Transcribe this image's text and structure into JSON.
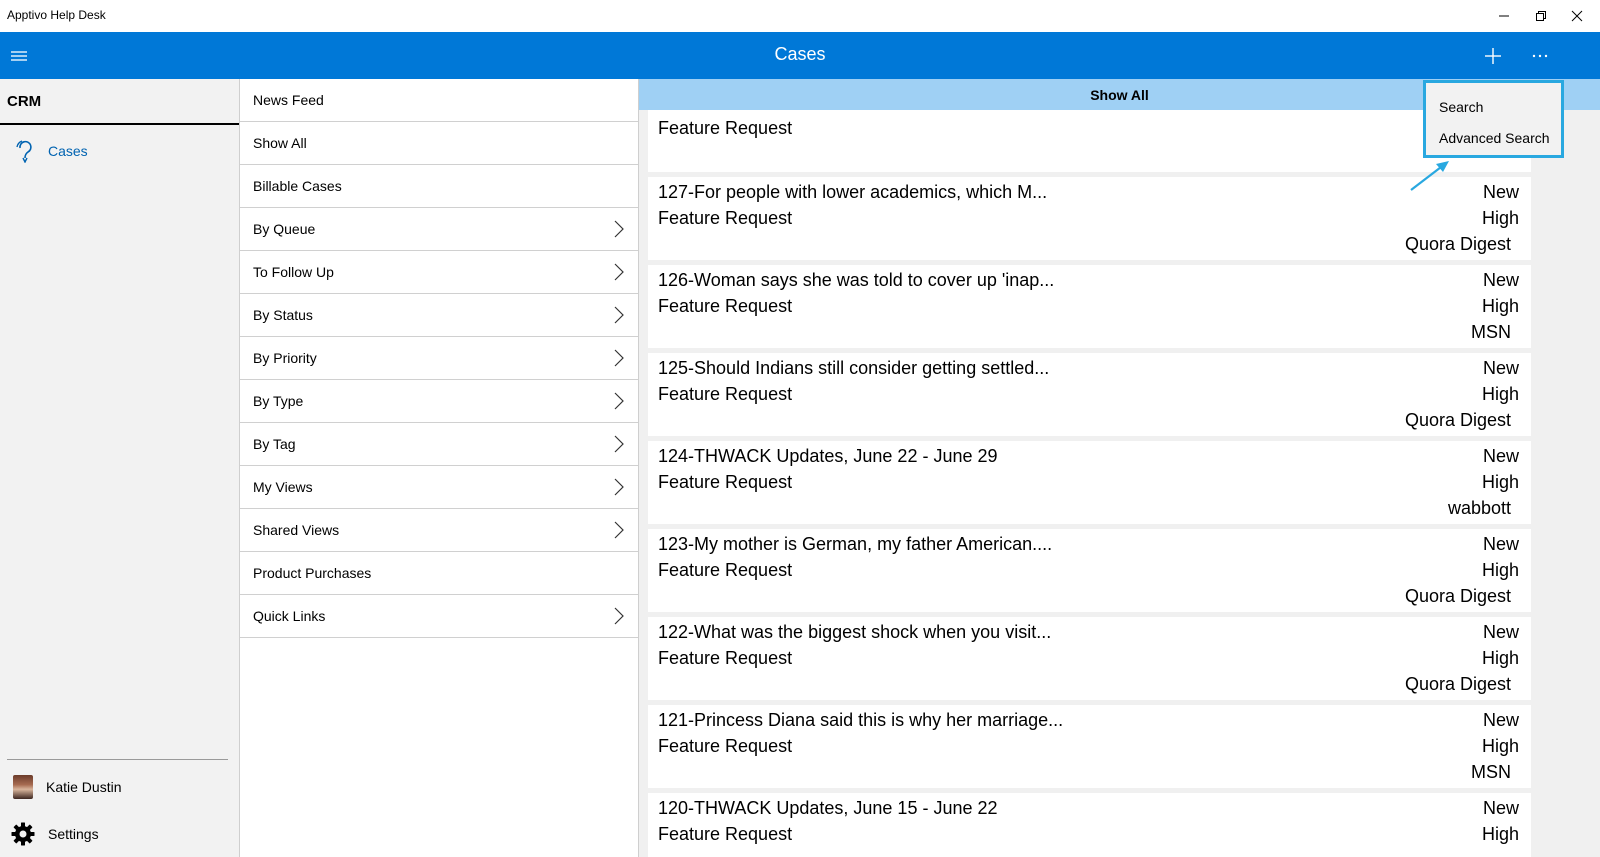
{
  "window": {
    "title": "Apptivo Help Desk"
  },
  "header": {
    "title": "Cases"
  },
  "sidebar": {
    "section": "CRM",
    "nav_item": "Cases",
    "user": "Katie Dustin",
    "settings": "Settings"
  },
  "menu": {
    "items": [
      {
        "label": "News Feed",
        "has_submenu": false
      },
      {
        "label": "Show All",
        "has_submenu": false
      },
      {
        "label": "Billable Cases",
        "has_submenu": false
      },
      {
        "label": "By Queue",
        "has_submenu": true
      },
      {
        "label": "To Follow Up",
        "has_submenu": true
      },
      {
        "label": "By Status",
        "has_submenu": true
      },
      {
        "label": "By Priority",
        "has_submenu": true
      },
      {
        "label": "By Type",
        "has_submenu": true
      },
      {
        "label": "By Tag",
        "has_submenu": true
      },
      {
        "label": "My Views",
        "has_submenu": true
      },
      {
        "label": "Shared Views",
        "has_submenu": true
      },
      {
        "label": "Product Purchases",
        "has_submenu": false
      },
      {
        "label": "Quick Links",
        "has_submenu": true
      }
    ]
  },
  "content": {
    "list_title": "Show All",
    "first_card_type": "Feature Request",
    "cases": [
      {
        "title": "127-For people with lower academics, which M...",
        "type": "Feature Request",
        "status": "New",
        "priority": "High",
        "source": "Quora Digest"
      },
      {
        "title": "126-Woman says she was told to cover up 'inap...",
        "type": "Feature Request",
        "status": "New",
        "priority": "High",
        "source": "MSN"
      },
      {
        "title": "125-Should Indians still consider getting settled...",
        "type": "Feature Request",
        "status": "New",
        "priority": "High",
        "source": "Quora Digest"
      },
      {
        "title": "124-THWACK Updates, June 22 - June 29",
        "type": "Feature Request",
        "status": "New",
        "priority": "High",
        "source": "wabbott"
      },
      {
        "title": "123-My mother is German, my father American....",
        "type": "Feature Request",
        "status": "New",
        "priority": "High",
        "source": "Quora Digest"
      },
      {
        "title": "122-What was the biggest shock when you visit...",
        "type": "Feature Request",
        "status": "New",
        "priority": "High",
        "source": "Quora Digest"
      },
      {
        "title": "121-Princess Diana said this is why her marriage...",
        "type": "Feature Request",
        "status": "New",
        "priority": "High",
        "source": "MSN"
      },
      {
        "title": "120-THWACK Updates, June 15 - June 22",
        "type": "Feature Request",
        "status": "New",
        "priority": "High",
        "source": ""
      }
    ]
  },
  "popup": {
    "items": [
      "Search",
      "Advanced Search"
    ],
    "border_color": "#29a8e0"
  },
  "colors": {
    "accent": "#0078d7",
    "list_header": "#9fd0f4",
    "link": "#0063b1"
  }
}
